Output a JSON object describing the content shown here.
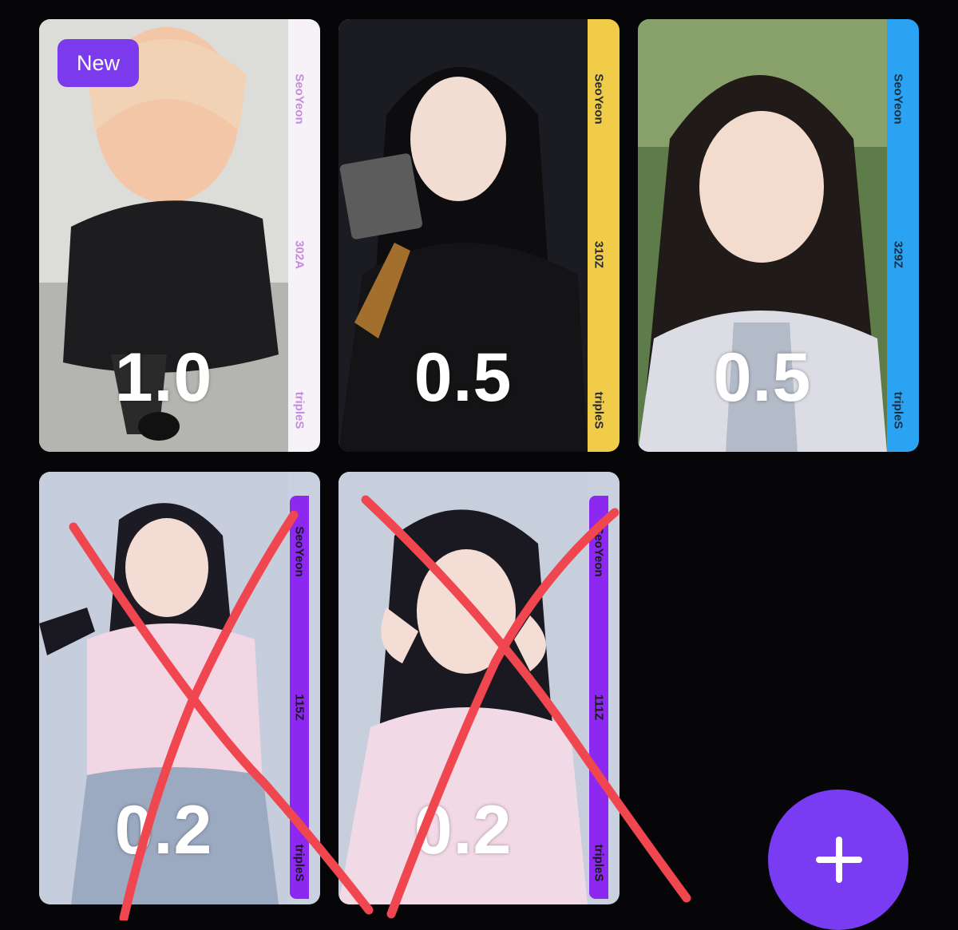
{
  "cards": [
    {
      "member": "SeoYeon",
      "number": "302A",
      "group": "tripleS",
      "price": "1.0",
      "badge": "New",
      "strip_color": "#f7f2f8",
      "text_color": "#c68be0",
      "crossed": false
    },
    {
      "member": "SeoYeon",
      "number": "310Z",
      "group": "tripleS",
      "price": "0.5",
      "badge": "",
      "strip_color": "#f1cc48",
      "text_color": "#2a2a2a",
      "crossed": false
    },
    {
      "member": "SeoYeon",
      "number": "329Z",
      "group": "tripleS",
      "price": "0.5",
      "badge": "",
      "strip_color": "#2aa3f2",
      "text_color": "#1d2d3d",
      "crossed": false
    },
    {
      "member": "SeoYeon",
      "number": "115Z",
      "group": "tripleS",
      "price": "0.2",
      "badge": "",
      "strip_color": "#8c28ef",
      "text_color": "#1a1a1a",
      "crossed": true
    },
    {
      "member": "SeoYeon",
      "number": "111Z",
      "group": "tripleS",
      "price": "0.2",
      "badge": "",
      "strip_color": "#8c28ef",
      "text_color": "#1a1a1a",
      "crossed": true
    }
  ],
  "add_button": {
    "icon": "plus-icon",
    "color": "#7a3cf2"
  },
  "cross_color": "#f0464f"
}
